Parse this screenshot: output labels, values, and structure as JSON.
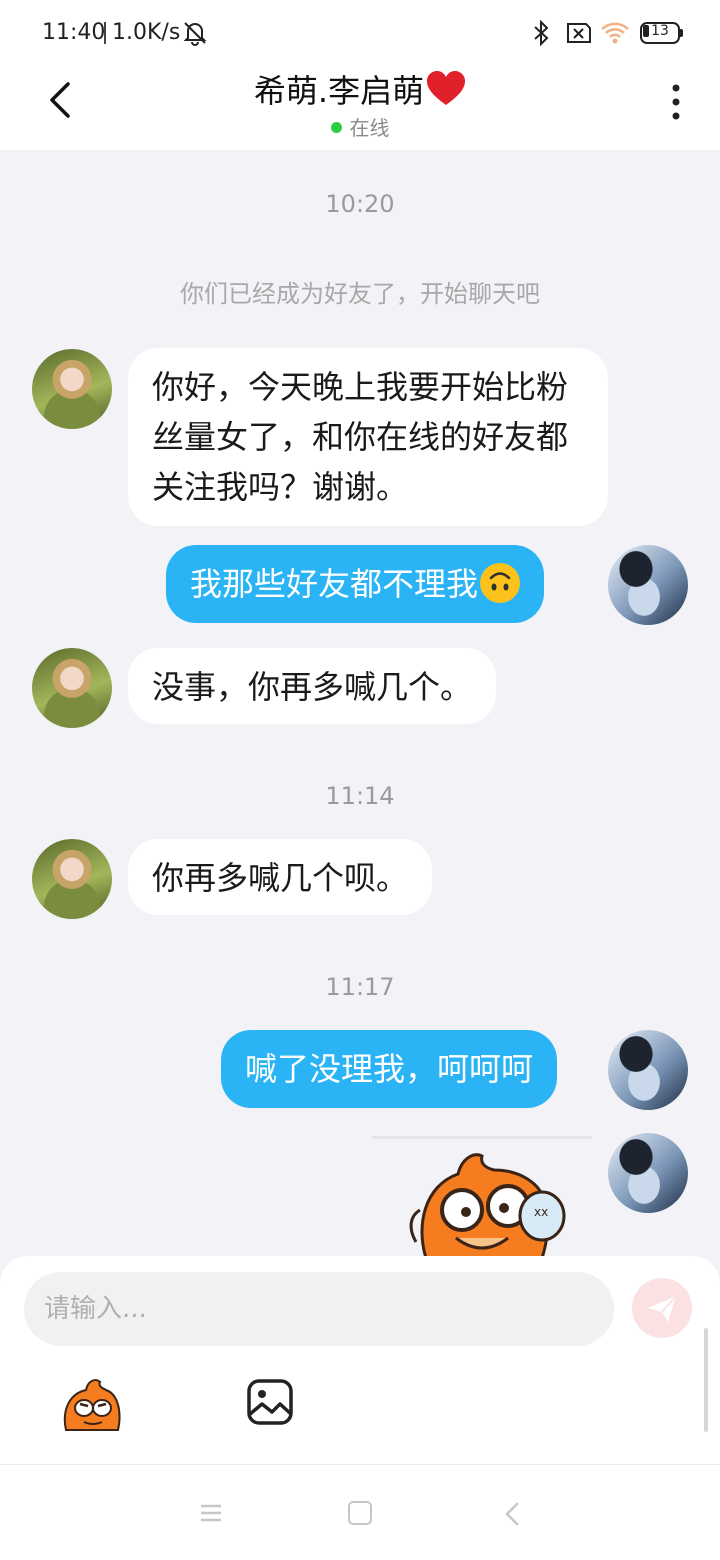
{
  "status_bar": {
    "time": "11:40",
    "network_speed": "1.0K/s",
    "battery_level": "13",
    "icons": [
      "mute-bell-icon",
      "bluetooth-icon",
      "sim-disabled-icon",
      "wifi-icon",
      "battery-icon"
    ]
  },
  "header": {
    "title": "希萌.李启萌",
    "title_emoji": "heart-icon",
    "status": "在线",
    "status_color": "#2ecc40"
  },
  "chat": {
    "timestamp_1": "10:20",
    "system_message": "你们已经成为好友了，开始聊天吧",
    "messages": [
      {
        "side": "in",
        "text": "你好，今天晚上我要开始比粉丝量女了，和你在线的好友都关注我吗？谢谢。"
      },
      {
        "side": "out",
        "text": "我那些好友都不理我",
        "emoji": "upside-down-face"
      },
      {
        "side": "in",
        "text": "没事，你再多喊几个。"
      },
      {
        "side": "in",
        "text": "你再多喊几个呗。"
      },
      {
        "side": "out",
        "text": "喊了没理我，呵呵呵"
      },
      {
        "side": "out",
        "sticker": "cartoon-fox-sticker"
      }
    ],
    "timestamp_2": "11:14",
    "timestamp_3": "11:17",
    "out_bubble_color": "#2ab4f5"
  },
  "composer": {
    "placeholder": "请输入...",
    "send_color": "#fbe1e1"
  }
}
